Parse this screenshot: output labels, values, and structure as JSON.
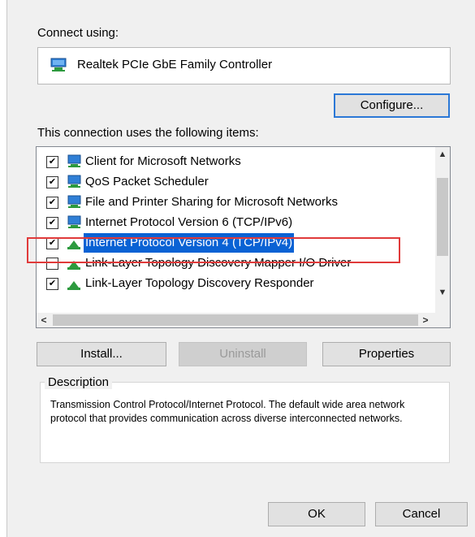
{
  "connect_using_label": "Connect using:",
  "adapter": {
    "name": "Realtek PCIe GbE Family Controller",
    "icon": "network-adapter-icon"
  },
  "buttons": {
    "configure": "Configure...",
    "install": "Install...",
    "uninstall": "Uninstall",
    "properties": "Properties",
    "ok": "OK",
    "cancel": "Cancel"
  },
  "items_label": "This connection uses the following items:",
  "items": [
    {
      "label": "Client for Microsoft Networks",
      "checked": true,
      "icon": "network-client-icon"
    },
    {
      "label": "QoS Packet Scheduler",
      "checked": true,
      "icon": "network-service-icon"
    },
    {
      "label": "File and Printer Sharing for Microsoft Networks",
      "checked": true,
      "icon": "network-service-icon"
    },
    {
      "label": "Internet Protocol Version 6 (TCP/IPv6)",
      "checked": true,
      "icon": "network-protocol-icon"
    },
    {
      "label": "Internet Protocol Version 4 (TCP/IPv4)",
      "checked": true,
      "selected": true,
      "icon": "network-protocol-icon"
    },
    {
      "label": "Link-Layer Topology Discovery Mapper I/O Driver",
      "checked": false,
      "icon": "network-protocol-icon"
    },
    {
      "label": "Link-Layer Topology Discovery Responder",
      "checked": true,
      "icon": "network-protocol-icon"
    }
  ],
  "description": {
    "title": "Description",
    "text": "Transmission Control Protocol/Internet Protocol. The default wide area network protocol that provides communication across diverse interconnected networks."
  },
  "colors": {
    "selection": "#0a62d4",
    "highlight_frame": "#e03a3a",
    "focus": "#2b78d6"
  }
}
